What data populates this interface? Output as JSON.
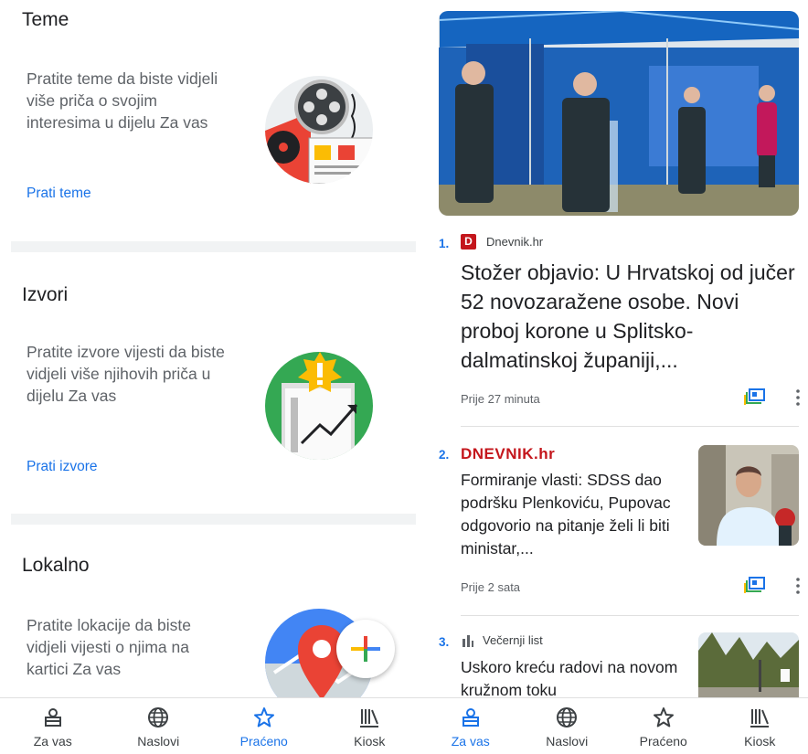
{
  "left": {
    "sections": [
      {
        "title": "Teme",
        "description": "Pratite teme da biste vidjeli više priča o svojim interesima u dijelu Za vas",
        "link": "Prati teme"
      },
      {
        "title": "Izvori",
        "description": "Pratite izvore vijesti da biste vidjeli više njihovih priča u dijelu Za vas",
        "link": "Prati izvore"
      },
      {
        "title": "Lokalno",
        "description": "Pratite lokacije da biste vidjeli vijesti o njima na kartici Za vas"
      }
    ],
    "nav": [
      {
        "label": "Za vas",
        "icon": "for-you-icon"
      },
      {
        "label": "Naslovi",
        "icon": "globe-icon"
      },
      {
        "label": "Praćeno",
        "icon": "star-icon",
        "active": true
      },
      {
        "label": "Kiosk",
        "icon": "newsstand-icon"
      }
    ]
  },
  "right": {
    "articles": [
      {
        "rank": "1.",
        "source": "Dnevnik.hr",
        "logo_letter": "D",
        "headline": "Stožer objavio: U Hrvatskoj od jučer 52 novozaražene osobe. Novi proboj korone u Splitsko-dalmatinskoj županiji,...",
        "time": "Prije 27 minuta"
      },
      {
        "rank": "2.",
        "source_logo_text": "DNEVNIK.hr",
        "headline": "Formiranje vlasti: SDSS dao podršku Plenkoviću, Pupovac odgovorio na pitanje želi li biti ministar,...",
        "time": "Prije 2 sata"
      },
      {
        "rank": "3.",
        "source": "Večernji list",
        "headline": "Uskoro kreću radovi na novom kružnom toku"
      }
    ],
    "nav": [
      {
        "label": "Za vas",
        "icon": "for-you-icon",
        "active": true
      },
      {
        "label": "Naslovi",
        "icon": "globe-icon"
      },
      {
        "label": "Praćeno",
        "icon": "star-icon"
      },
      {
        "label": "Kiosk",
        "icon": "newsstand-icon"
      }
    ]
  },
  "colors": {
    "accent": "#1a73e8",
    "text": "#202124",
    "secondary": "#5f6368",
    "dnevnik_red": "#c4161c"
  }
}
